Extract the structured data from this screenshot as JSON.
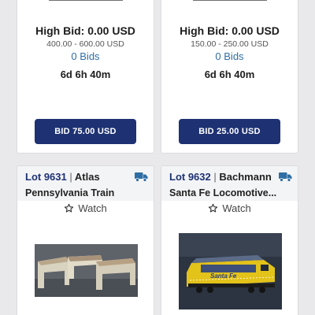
{
  "cards": [
    {
      "high_bid": "High Bid: 0.00 USD",
      "estimate": "400.00 - 600.00 USD",
      "bids": "0 Bids",
      "time_left": "6d 6h 40m",
      "bid_button": "BID 75.00 USD"
    },
    {
      "high_bid": "High Bid: 0.00 USD",
      "estimate": "150.00 - 250.00 USD",
      "bids": "0 Bids",
      "time_left": "6d 6h 40m",
      "bid_button": "BID 25.00 USD"
    },
    {
      "lot": "Lot 9631",
      "separator": "|",
      "maker": "Atlas",
      "title": "Pennsylvania Train",
      "watch": "Watch",
      "shipping_icon": "truck-icon",
      "image_subject": "bridge-platforms"
    },
    {
      "lot": "Lot 9632",
      "separator": "|",
      "maker": "Bachmann",
      "title": "Santa Fe Locomotive...",
      "watch": "Watch",
      "shipping_icon": "truck-icon",
      "image_subject": "locomotive",
      "image_text": "Santa Fe"
    }
  ],
  "colors": {
    "accent": "#1e3273",
    "link": "#2f6ea5",
    "background": "#e9e9ec",
    "header": "#f3f4f6"
  }
}
